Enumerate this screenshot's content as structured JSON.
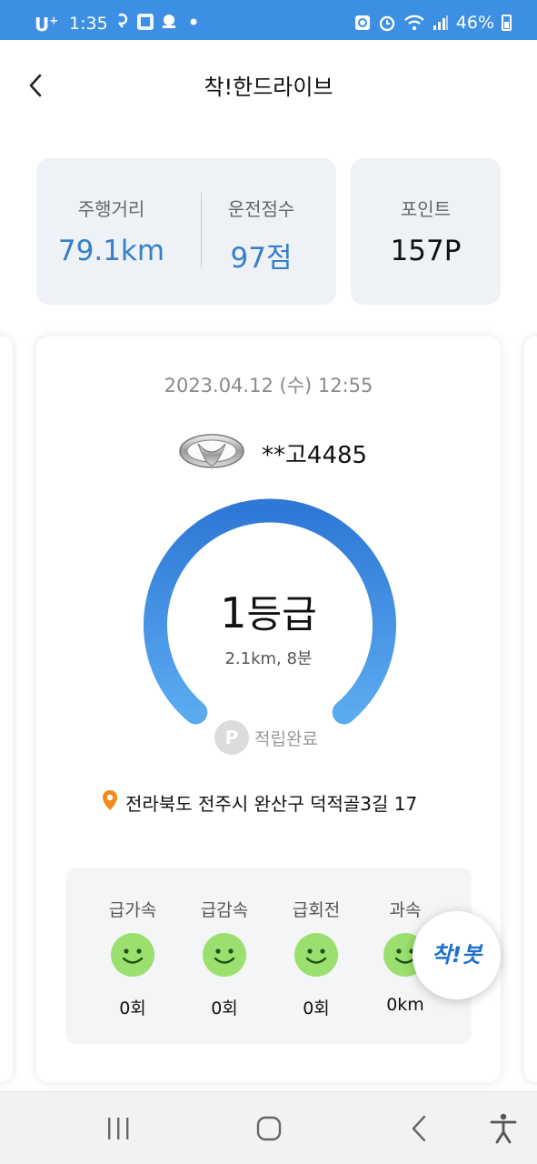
{
  "status_bar": {
    "carrier": "U",
    "carrier_sup": "+",
    "time": "1:35",
    "battery": "46%",
    "icons": [
      "network-icon",
      "app-notification-icon",
      "app-notification-icon",
      "dot-icon",
      "sync-icon",
      "alarm-icon",
      "wifi-icon",
      "signal-icon",
      "battery-icon"
    ]
  },
  "header": {
    "title": "착!한드라이브",
    "back_icon": "chevron-left-icon"
  },
  "summary": {
    "distance_label": "주행거리",
    "distance_value": "79.1km",
    "score_label": "운전점수",
    "score_value": "97점",
    "points_label": "포인트",
    "points_value": "157P"
  },
  "trip": {
    "datetime": "2023.04.12 (수) 12:55",
    "car_logo_icon": "car-brand-logo-icon",
    "plate": "**고4485",
    "grade_number": "1",
    "grade_suffix": "등급",
    "summary": "2.1km, 8분",
    "point_badge": "P",
    "point_status": "적립완료",
    "location_icon": "location-pin-icon",
    "address": "전라북도 전주시 완산구 덕적골3길 17",
    "events": [
      {
        "label": "급가속",
        "count": "0회",
        "icon": "smile-face-icon"
      },
      {
        "label": "급감속",
        "count": "0회",
        "icon": "smile-face-icon"
      },
      {
        "label": "급회전",
        "count": "0회",
        "icon": "smile-face-icon"
      },
      {
        "label": "과속",
        "count": "0km",
        "icon": "smile-face-icon"
      }
    ]
  },
  "bot_button": {
    "label": "착!봇"
  },
  "nav": {
    "icons": [
      "recent-apps-icon",
      "home-icon",
      "back-icon",
      "accessibility-icon"
    ]
  },
  "colors": {
    "status_bar": "#3d8fe3",
    "accent_blue": "#3580c8",
    "gauge_start": "#2f78d6",
    "gauge_end": "#5aaaf0",
    "face_green": "#9be06f",
    "pin_orange": "#f28a1e"
  }
}
